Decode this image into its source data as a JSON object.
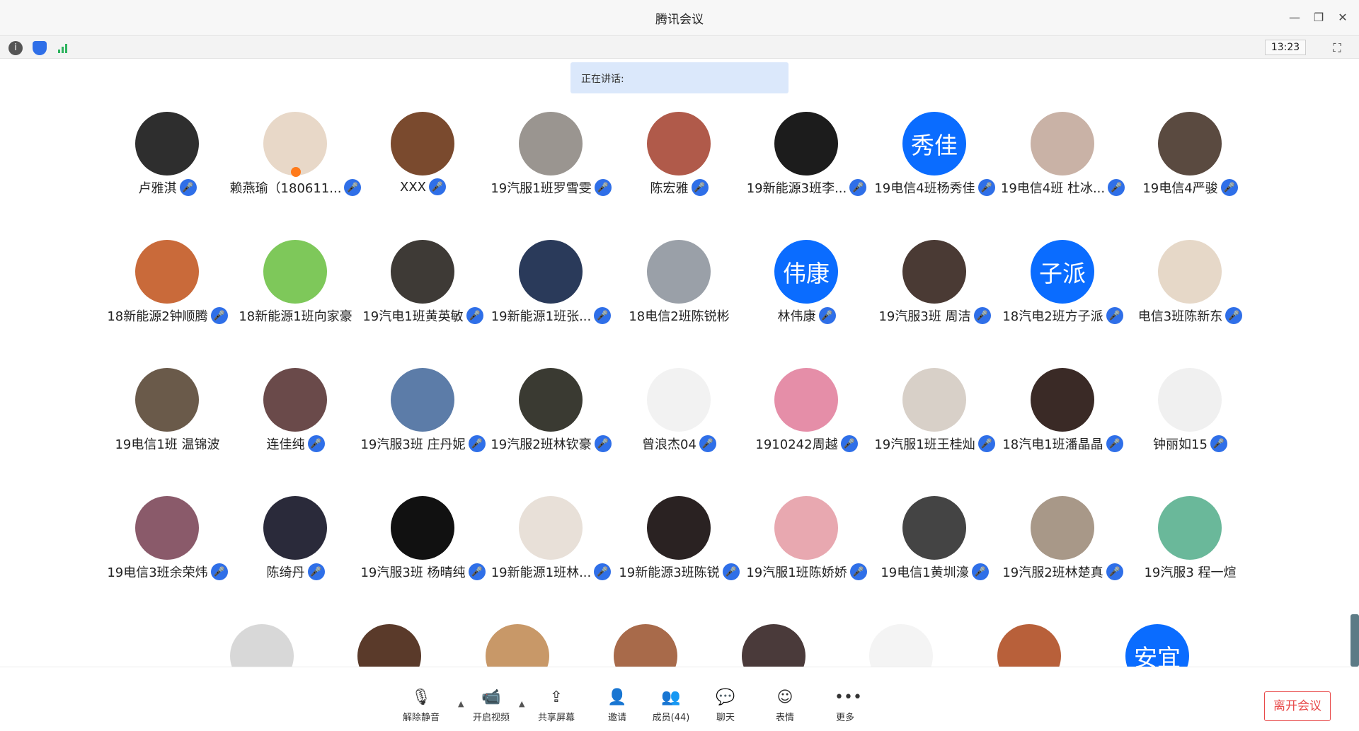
{
  "window": {
    "title": "腾讯会议",
    "clock": "13:23"
  },
  "speaking_label": "正在讲话:",
  "participants": [
    {
      "name": "卢雅淇",
      "av": "#2e2e2e"
    },
    {
      "name": "赖燕瑜（180611...",
      "av": "#e8d8c8",
      "host": true
    },
    {
      "name": "XXX",
      "av": "#7a4a2e"
    },
    {
      "name": "19汽服1班罗雪雯",
      "av": "#9a9590"
    },
    {
      "name": "陈宏雅",
      "av": "#b05a4a"
    },
    {
      "name": "19新能源3班李...",
      "av": "#1c1c1c"
    },
    {
      "name": "19电信4班杨秀佳",
      "text": "秀佳"
    },
    {
      "name": "19电信4班  杜冰...",
      "av": "#c9b2a6"
    },
    {
      "name": "19电信4严骏",
      "av": "#5a4a40"
    },
    {
      "name": "18新能源2钟顺腾",
      "av": "#c96a3a"
    },
    {
      "name": "18新能源1班向家豪",
      "av": "#7ec85a",
      "nomic": true
    },
    {
      "name": "19汽电1班黄英敏",
      "av": "#3e3a36"
    },
    {
      "name": "19新能源1班张...",
      "av": "#2a3a5a"
    },
    {
      "name": "18电信2班陈锐彬",
      "av": "#9aa0a8",
      "nomic": true
    },
    {
      "name": "林伟康",
      "text": "伟康"
    },
    {
      "name": "19汽服3班 周洁",
      "av": "#4a3a34"
    },
    {
      "name": "18汽电2班方子派",
      "text": "子派"
    },
    {
      "name": "电信3班陈新东",
      "av": "#e6d8c8"
    },
    {
      "name": "19电信1班 温锦波",
      "av": "#6a5a4a",
      "nomic": true
    },
    {
      "name": "连佳纯",
      "av": "#6a4a4a"
    },
    {
      "name": "19汽服3班 庄丹妮",
      "av": "#5c7ca8"
    },
    {
      "name": "19汽服2班林钦豪",
      "av": "#3a3a32"
    },
    {
      "name": "曾浪杰04",
      "av": "#f2f2f2"
    },
    {
      "name": "1910242周越",
      "av": "#e58ea8"
    },
    {
      "name": "19汽服1班王桂灿",
      "av": "#d8d0c8"
    },
    {
      "name": "18汽电1班潘晶晶",
      "av": "#3a2a26"
    },
    {
      "name": "钟丽如15",
      "av": "#f0f0f0"
    },
    {
      "name": "19电信3班余荣炜",
      "av": "#8a5a6a"
    },
    {
      "name": "陈绮丹",
      "av": "#2a2a3a"
    },
    {
      "name": "19汽服3班 杨晴纯",
      "av": "#111111"
    },
    {
      "name": "19新能源1班林...",
      "av": "#e8e0d8"
    },
    {
      "name": "19新能源3班陈锐",
      "av": "#2a2222"
    },
    {
      "name": "19汽服1班陈娇娇",
      "av": "#e8a8b0"
    },
    {
      "name": "19电信1黄圳濠",
      "av": "#444444"
    },
    {
      "name": "19汽服2班林楚真",
      "av": "#a89888"
    },
    {
      "name": "19汽服3  程一煊",
      "av": "#6ab89a",
      "nomic": true
    },
    {
      "name": "",
      "av": "#d8d8d8"
    },
    {
      "name": "",
      "av": "#5a3a2a"
    },
    {
      "name": "",
      "av": "#c89868"
    },
    {
      "name": "",
      "av": "#a86a4a"
    },
    {
      "name": "",
      "av": "#4a3a3a"
    },
    {
      "name": "",
      "av": "#f4f4f4"
    },
    {
      "name": "",
      "av": "#b8603a"
    },
    {
      "name": "",
      "text": "安宜"
    }
  ],
  "toolbar": {
    "unmute": "解除静音",
    "video": "开启视频",
    "share": "共享屏幕",
    "invite": "邀请",
    "members": "成员(44)",
    "chat": "聊天",
    "emoji": "表情",
    "more": "更多",
    "leave": "离开会议"
  },
  "colors": {
    "accent": "#0a6cff",
    "mic": "#2f6fe8",
    "leave": "#e84a4a"
  }
}
